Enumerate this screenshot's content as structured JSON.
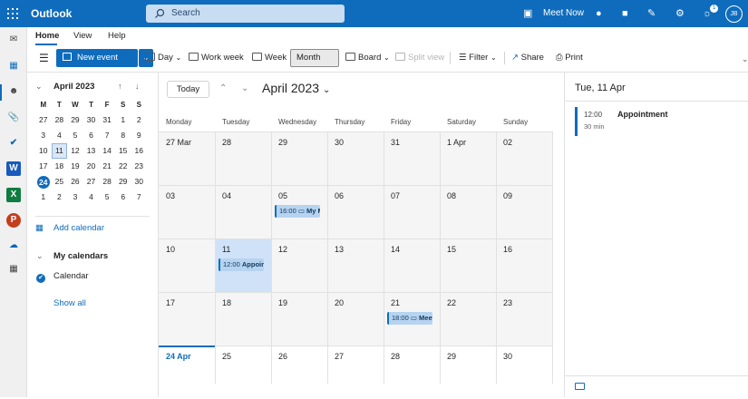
{
  "app": {
    "name": "Outlook",
    "search_placeholder": "Search",
    "meet_now": "Meet Now",
    "avatar_initials": "JB",
    "notification_count": "1"
  },
  "tabs": [
    {
      "label": "Home"
    },
    {
      "label": "View"
    },
    {
      "label": "Help"
    }
  ],
  "ribbon": {
    "new_event": "New event",
    "day": "Day",
    "work_week": "Work week",
    "week": "Week",
    "month": "Month",
    "board": "Board",
    "split_view": "Split view",
    "filter": "Filter",
    "share": "Share",
    "print": "Print"
  },
  "mini_calendar": {
    "title": "April 2023",
    "dow": [
      "M",
      "T",
      "W",
      "T",
      "F",
      "S",
      "S"
    ],
    "weeks": [
      [
        "27",
        "28",
        "29",
        "30",
        "31",
        "1",
        "2"
      ],
      [
        "3",
        "4",
        "5",
        "6",
        "7",
        "8",
        "9"
      ],
      [
        "10",
        "11",
        "12",
        "13",
        "14",
        "15",
        "16"
      ],
      [
        "17",
        "18",
        "19",
        "20",
        "21",
        "22",
        "23"
      ],
      [
        "24",
        "25",
        "26",
        "27",
        "28",
        "29",
        "30"
      ],
      [
        "1",
        "2",
        "3",
        "4",
        "5",
        "6",
        "7"
      ]
    ]
  },
  "left_pane": {
    "add_calendar": "Add calendar",
    "my_calendars": "My calendars",
    "calendar": "Calendar",
    "show_all": "Show all"
  },
  "calendar": {
    "today_button": "Today",
    "month_title": "April 2023",
    "dow": [
      "Monday",
      "Tuesday",
      "Wednesday",
      "Thursday",
      "Friday",
      "Saturday",
      "Sunday"
    ],
    "weeks": [
      [
        "27 Mar",
        "28",
        "29",
        "30",
        "31",
        "1 Apr",
        "02"
      ],
      [
        "03",
        "04",
        "05",
        "06",
        "07",
        "08",
        "09"
      ],
      [
        "10",
        "11",
        "12",
        "13",
        "14",
        "15",
        "16"
      ],
      [
        "17",
        "18",
        "19",
        "20",
        "21",
        "22",
        "23"
      ],
      [
        "24 Apr",
        "25",
        "26",
        "27",
        "28",
        "29",
        "30"
      ]
    ],
    "events": [
      {
        "time": "16:00",
        "title": "My M"
      },
      {
        "time": "12:00",
        "title": "Appoint"
      },
      {
        "time": "18:00",
        "title": "Meet"
      }
    ]
  },
  "details": {
    "date": "Tue, 11 Apr",
    "time": "12:00",
    "duration": "30 min",
    "title": "Appointment"
  },
  "colors": {
    "accent": "#0f6cbd",
    "selected_day": "#cfe2f8",
    "event_bg": "#b6d3f0"
  }
}
